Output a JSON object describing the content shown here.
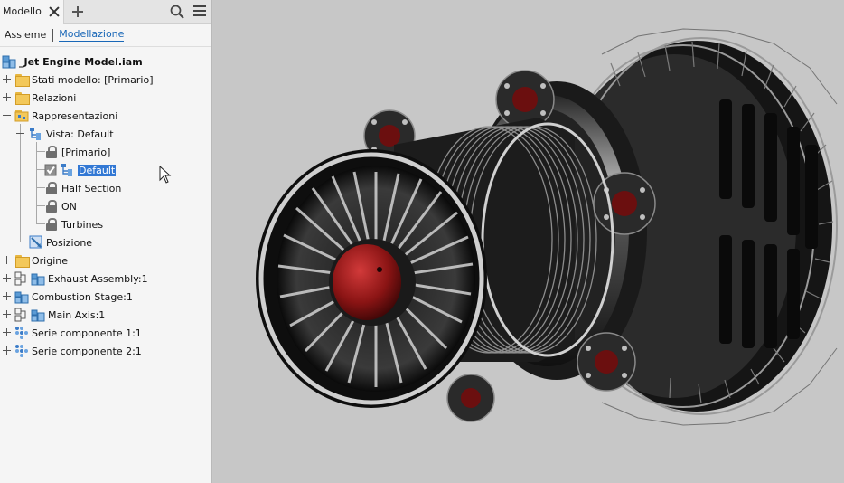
{
  "browser": {
    "tab": {
      "label": "Modello"
    },
    "subtabs": [
      {
        "label": "Assieme"
      },
      {
        "label": "Modellazione"
      }
    ],
    "tree": {
      "root": "_Jet Engine Model.iam",
      "stati": "Stati modello: [Primario]",
      "relazioni": "Relazioni",
      "rappresentazioni": "Rappresentazioni",
      "vista": "Vista: Default",
      "primario": "[Primario]",
      "default": "Default",
      "half_section": "Half Section",
      "on": "ON",
      "turbines": "Turbines",
      "posizione": "Posizione",
      "origine": "Origine",
      "exhaust": "Exhaust Assembly:1",
      "combustion": "Combustion Stage:1",
      "main_axis": "Main Axis:1",
      "serie1": "Serie componente 1:1",
      "serie2": "Serie componente 2:1"
    }
  },
  "viewport": {
    "background": "#c7c7c7",
    "model": "jet-engine-3d-model"
  },
  "colors": {
    "accent": "#1967b7",
    "selection": "#3278d4",
    "folder": "#f3c85a",
    "engine_dark": "#141414",
    "engine_red": "#8a1414"
  }
}
